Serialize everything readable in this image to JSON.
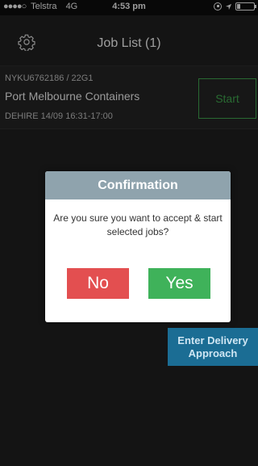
{
  "status_bar": {
    "signal": "●●●●○",
    "carrier": "Telstra",
    "network": "4G",
    "time": "4:53 pm",
    "battery_level": 0.2
  },
  "header": {
    "settings_icon": "gear-icon",
    "title": "Job List (1)"
  },
  "job": {
    "reference": "NYKU6762186 / 22G1",
    "name": "Port Melbourne Containers",
    "meta": "DEHIRE  14/09 16:31-17:00",
    "start_label": "Start"
  },
  "approach_button": {
    "label": "Enter Delivery Approach"
  },
  "dialog": {
    "title": "Confirmation",
    "message": "Are you sure you want to accept & start selected jobs?",
    "no_label": "No",
    "yes_label": "Yes"
  },
  "colors": {
    "background": "#1f1f1f",
    "start_green": "#3fa34d",
    "dialog_header": "#8fa3ad",
    "no_red": "#e34f50",
    "yes_green": "#3fb25a",
    "approach_blue": "#1b6d94"
  }
}
